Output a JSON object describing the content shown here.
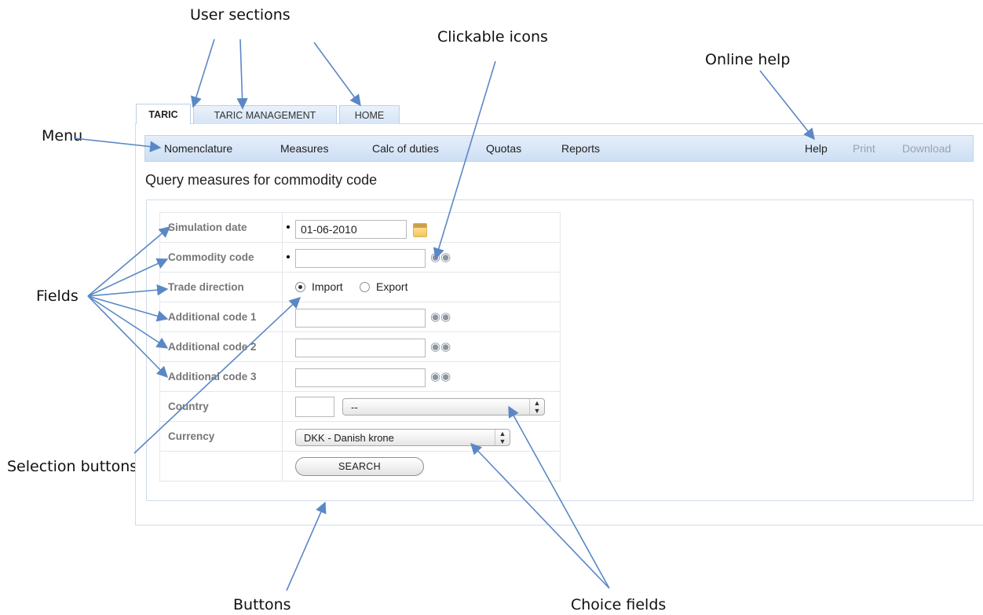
{
  "callouts": {
    "user_sections": "User sections",
    "clickable_icons": "Clickable icons",
    "online_help": "Online help",
    "menu": "Menu",
    "fields": "Fields",
    "selection_buttons": "Selection buttons",
    "buttons": "Buttons",
    "choice_fields": "Choice fields"
  },
  "tabs": [
    {
      "label": "TARIC",
      "active": true
    },
    {
      "label": "TARIC MANAGEMENT",
      "active": false
    },
    {
      "label": "HOME",
      "active": false
    }
  ],
  "menu": {
    "nomenclature": "Nomenclature",
    "measures": "Measures",
    "calc_of_duties": "Calc of duties",
    "quotas": "Quotas",
    "reports": "Reports",
    "help": "Help",
    "print": "Print",
    "download": "Download"
  },
  "page_title": "Query measures for commodity code",
  "form": {
    "simulation_date": {
      "label": "Simulation date",
      "value": "01-06-2010"
    },
    "commodity_code": {
      "label": "Commodity code",
      "value": ""
    },
    "trade_direction": {
      "label": "Trade direction",
      "options": [
        "Import",
        "Export"
      ],
      "selected": "Import"
    },
    "additional_code_1": {
      "label": "Additional code 1",
      "value": ""
    },
    "additional_code_2": {
      "label": "Additional code 2",
      "value": ""
    },
    "additional_code_3": {
      "label": "Additional code 3",
      "value": ""
    },
    "country": {
      "label": "Country",
      "code": "",
      "selected": "--"
    },
    "currency": {
      "label": "Currency",
      "selected": "DKK - Danish krone"
    },
    "search_label": "SEARCH"
  },
  "icons": {
    "calendar": "calendar-icon",
    "lookup": "binoculars-icon",
    "select_arrows": "updown-arrows-icon"
  },
  "colors": {
    "menu_bar": "#d5e4f4",
    "arrows": "#5b88c5",
    "border": "#cfdce9"
  }
}
